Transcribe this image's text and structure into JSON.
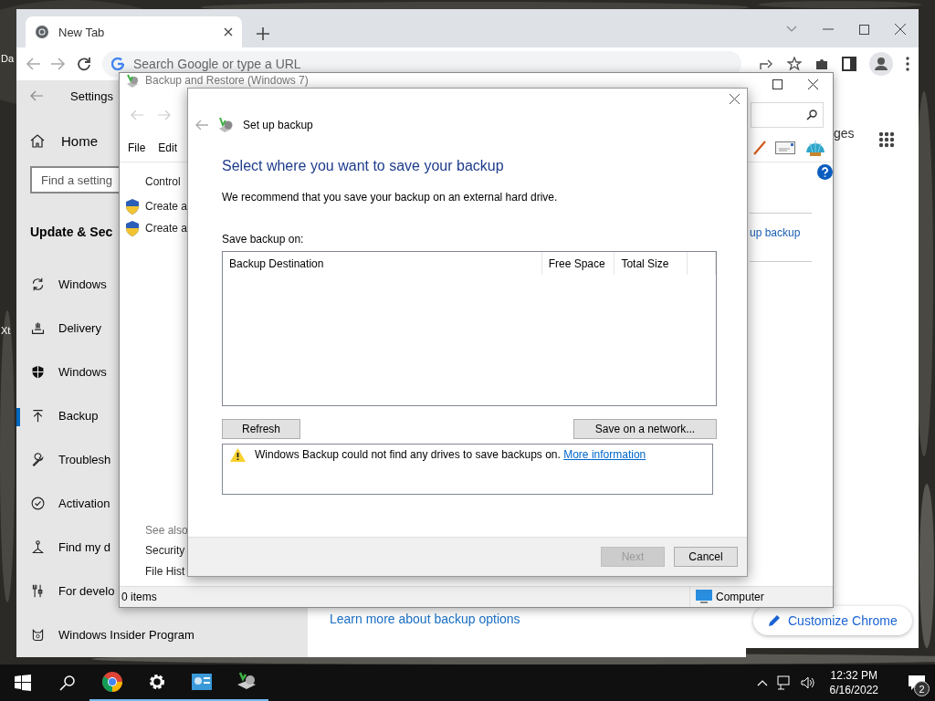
{
  "desktop": {
    "icon_labels": [
      "Da",
      "Xt"
    ]
  },
  "chrome": {
    "tab": {
      "title": "New Tab",
      "selected": true
    },
    "omnibox": {
      "placeholder": "Search Google or type a URL"
    },
    "partial_link": "ges",
    "customize_button": "Customize Chrome"
  },
  "settings": {
    "title": "Settings",
    "home": "Home",
    "search": {
      "placeholder": "Find a setting"
    },
    "section": "Update & Sec",
    "nav": [
      {
        "label": "Windows",
        "selected": false
      },
      {
        "label": "Delivery",
        "selected": false
      },
      {
        "label": "Windows",
        "selected": false
      },
      {
        "label": "Backup",
        "selected": true
      },
      {
        "label": "Troublesh",
        "selected": false
      },
      {
        "label": "Activation",
        "selected": false
      },
      {
        "label": "Find my d",
        "selected": false
      },
      {
        "label": "For develo",
        "selected": false
      },
      {
        "label": "Windows Insider Program",
        "selected": false
      }
    ],
    "link": "Learn more about backup options"
  },
  "backup_window": {
    "title": "Backup and Restore (Windows 7)",
    "menu": [
      "File",
      "Edit"
    ],
    "breadcrumb": "Control",
    "tasks": [
      "Create a",
      "Create a"
    ],
    "see_also_heading": "See also",
    "see_also": [
      "Security",
      "File Hist"
    ],
    "side_link": "up backup",
    "status": {
      "items": "0 items",
      "location": "Computer"
    }
  },
  "dialog": {
    "title": "Set up backup",
    "heading": "Select where you want to save your backup",
    "recommendation": "We recommend that you save your backup on an external hard drive.",
    "list_label": "Save backup on:",
    "columns": [
      "Backup Destination",
      "Free Space",
      "Total Size"
    ],
    "refresh_button": "Refresh",
    "network_button": "Save on a network...",
    "message": {
      "text": "Windows Backup could not find any drives to save backups on.",
      "link": "More information"
    },
    "footer_buttons": [
      {
        "label": "Next",
        "disabled": true
      },
      {
        "label": "Cancel",
        "disabled": false
      }
    ]
  },
  "taskbar": {
    "apps": [
      {
        "kind": "start",
        "running": false
      },
      {
        "kind": "search",
        "running": false
      },
      {
        "kind": "browser",
        "running": true
      },
      {
        "kind": "settings",
        "running": true
      },
      {
        "kind": "control-panel",
        "running": true
      },
      {
        "kind": "backup",
        "running": true
      }
    ],
    "clock": {
      "time": "12:32 PM",
      "date": "6/16/2022"
    },
    "notifications": "2"
  }
}
